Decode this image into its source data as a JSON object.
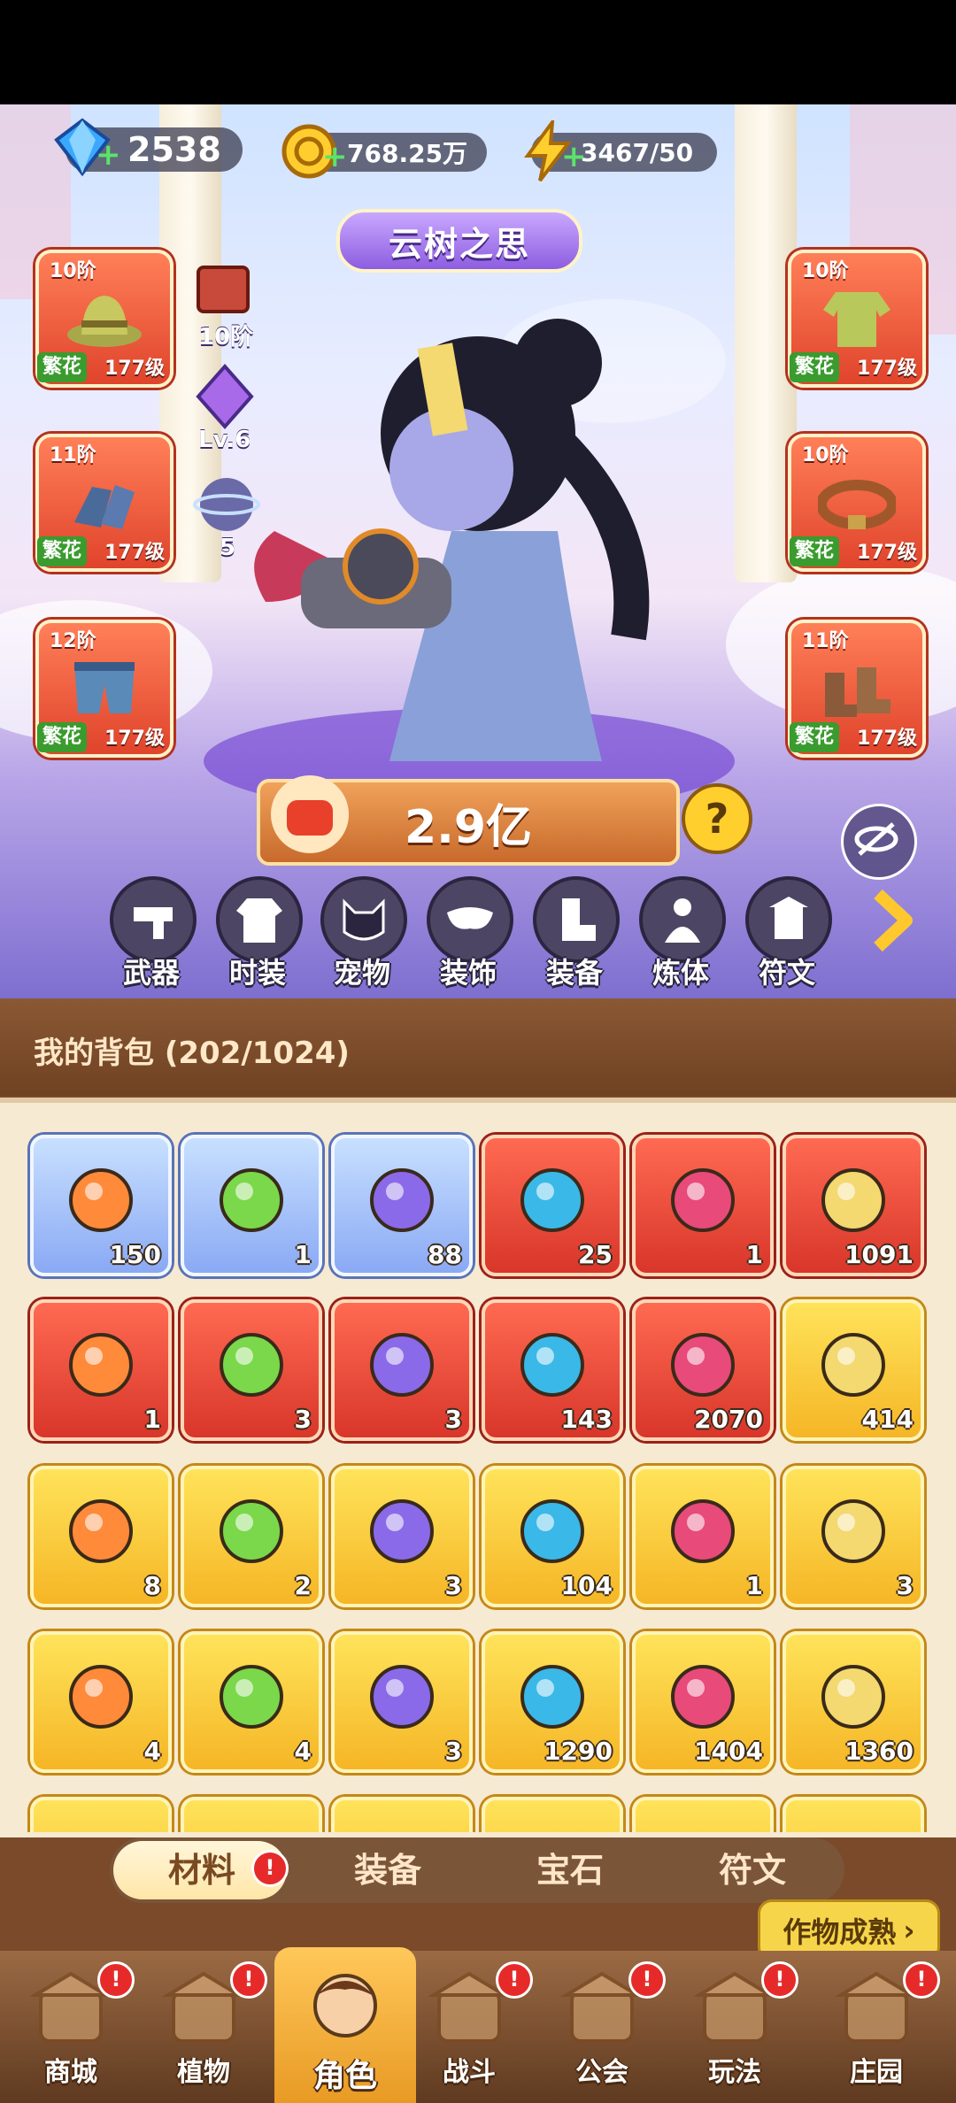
{
  "currency": {
    "gems": "2538",
    "gold": "768.25万",
    "energy": "3467/50"
  },
  "title_banner": "云树之思",
  "left_slots": [
    {
      "tier": "10阶",
      "tag": "繁花",
      "level": "177级",
      "item": "hat"
    },
    {
      "tier": "11阶",
      "tag": "繁花",
      "level": "177级",
      "item": "gloves"
    },
    {
      "tier": "12阶",
      "tag": "繁花",
      "level": "177级",
      "item": "pants"
    }
  ],
  "right_slots": [
    {
      "tier": "10阶",
      "tag": "繁花",
      "level": "177级",
      "item": "shirt"
    },
    {
      "tier": "10阶",
      "tag": "繁花",
      "level": "177级",
      "item": "belt"
    },
    {
      "tier": "11阶",
      "tag": "繁花",
      "level": "177级",
      "item": "boots"
    }
  ],
  "mini_stats": {
    "book_tier": "10阶",
    "gem_level": "Lv.6",
    "orb_count": "5"
  },
  "power": "2.9亿",
  "categories": [
    "武器",
    "时装",
    "宠物",
    "装饰",
    "装备",
    "炼体",
    "符文"
  ],
  "bag": {
    "title": "我的背包 (202/1024)",
    "items": [
      {
        "rarity": "blue",
        "icon": "golden-beetle-icon",
        "count": "150"
      },
      {
        "rarity": "blue",
        "icon": "syringe-icon",
        "count": "1"
      },
      {
        "rarity": "blue",
        "icon": "compass-orb-icon",
        "count": "88"
      },
      {
        "rarity": "red",
        "icon": "star-crystal-icon",
        "count": "25"
      },
      {
        "rarity": "red",
        "icon": "moon-star-icon",
        "count": "1"
      },
      {
        "rarity": "red",
        "icon": "potion-icon",
        "count": "1091"
      },
      {
        "rarity": "red",
        "icon": "green-capsule-icon",
        "count": "1"
      },
      {
        "rarity": "red",
        "icon": "green-pill-icon",
        "count": "3"
      },
      {
        "rarity": "red",
        "icon": "flower-portrait-icon",
        "count": "3"
      },
      {
        "rarity": "red",
        "icon": "hexagram-icon",
        "count": "143"
      },
      {
        "rarity": "red",
        "icon": "cube-cluster-icon",
        "count": "2070"
      },
      {
        "rarity": "gold",
        "icon": "skull-scroll-icon",
        "count": "414"
      },
      {
        "rarity": "gold",
        "icon": "ruby-key-icon",
        "count": "8"
      },
      {
        "rarity": "gold",
        "icon": "gold-key-icon",
        "count": "2"
      },
      {
        "rarity": "gold",
        "icon": "emerald-key-icon",
        "count": "3"
      },
      {
        "rarity": "gold",
        "icon": "fire-pyramid-icon",
        "count": "104"
      },
      {
        "rarity": "gold",
        "icon": "star-compass-icon",
        "count": "1"
      },
      {
        "rarity": "gold",
        "icon": "mushroom-icon",
        "count": "3"
      },
      {
        "rarity": "gold",
        "icon": "red-book-icon",
        "count": "4"
      },
      {
        "rarity": "gold",
        "icon": "green-cube-icon",
        "count": "4"
      },
      {
        "rarity": "gold",
        "icon": "golden-flower-icon",
        "count": "3"
      },
      {
        "rarity": "gold",
        "icon": "tomato-crate-icon",
        "count": "1290"
      },
      {
        "rarity": "gold",
        "icon": "purple-veg-crate-icon",
        "count": "1404"
      },
      {
        "rarity": "gold",
        "icon": "grape-crate-icon",
        "count": "1360"
      }
    ]
  },
  "tabs": [
    "材料",
    "装备",
    "宝石",
    "符文"
  ],
  "crop_ready": "作物成熟",
  "nav": [
    "商城",
    "植物",
    "角色",
    "战斗",
    "公会",
    "玩法",
    "庄园"
  ],
  "colors": {
    "red_slot": "#e0442c",
    "blue_slot": "#8aa9f4",
    "gold_slot": "#f5b626",
    "badge": "#e62a2a",
    "grade_tag": "#3a9b2e"
  }
}
